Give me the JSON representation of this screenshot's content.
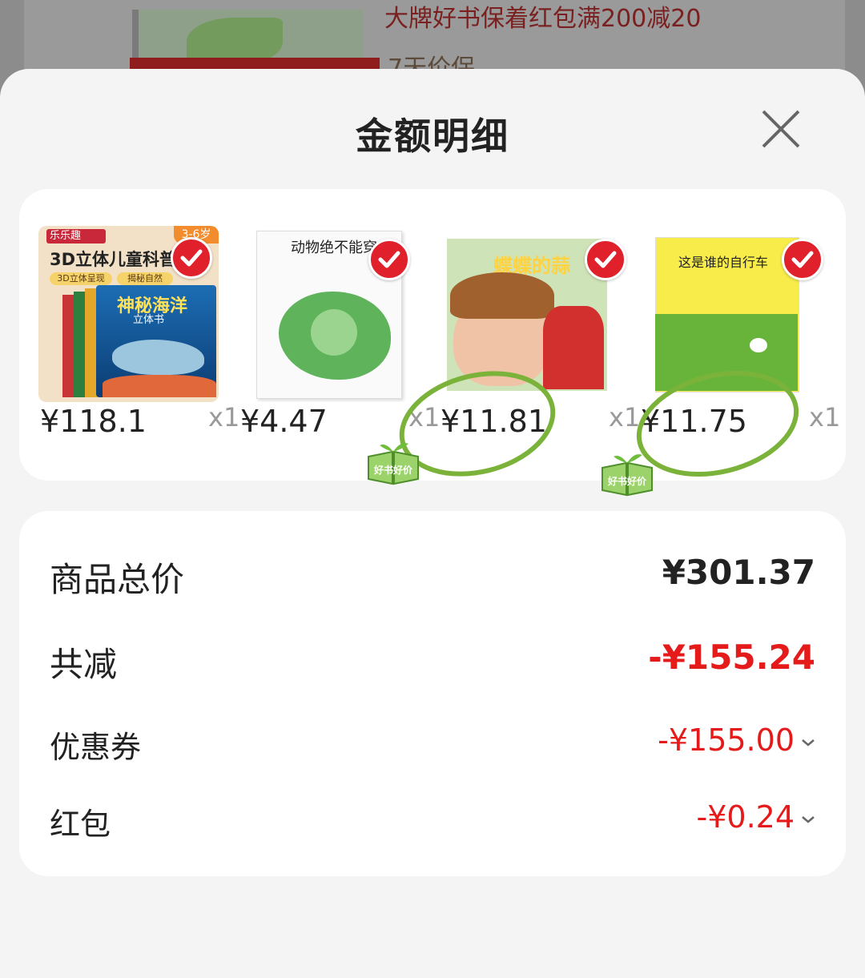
{
  "background": {
    "promo_text": "大牌好书保着红包满200减20",
    "guarantee_text": "7天价保"
  },
  "sheet": {
    "title": "金额明细",
    "close_icon": "close-icon"
  },
  "products": [
    {
      "price": "¥118.1",
      "qty": "x1",
      "cover_title": "3D立体儿童科普",
      "cover_brand": "乐乐趣",
      "cover_age": "3-6岁",
      "cover_series": "神秘海洋",
      "cover_sub": "立体书",
      "cover_tags": [
        "3D立体呈现",
        "揭秘自然"
      ],
      "selected": true,
      "badge": ""
    },
    {
      "price": "¥4.47",
      "qty": "x1",
      "cover_title": "动物绝不能穿衣",
      "selected": true,
      "badge": ""
    },
    {
      "price": "¥11.81",
      "qty": "x1",
      "cover_title": "蝶蝶的蒜",
      "selected": true,
      "badge": "好书好价"
    },
    {
      "price": "¥11.75",
      "qty": "x1",
      "cover_title": "这是谁的自行车",
      "selected": true,
      "badge": "好书好价"
    }
  ],
  "summary": {
    "total_label": "商品总价",
    "total_value": "¥301.37",
    "discount_label": "共减",
    "discount_value": "-¥155.24",
    "coupon_label": "优惠券",
    "coupon_value": "-¥155.00",
    "redpacket_label": "红包",
    "redpacket_value": "-¥0.24"
  },
  "colors": {
    "accent_red": "#e51b1b",
    "check_red": "#e0202a",
    "annotation_green": "#7bb33a"
  }
}
